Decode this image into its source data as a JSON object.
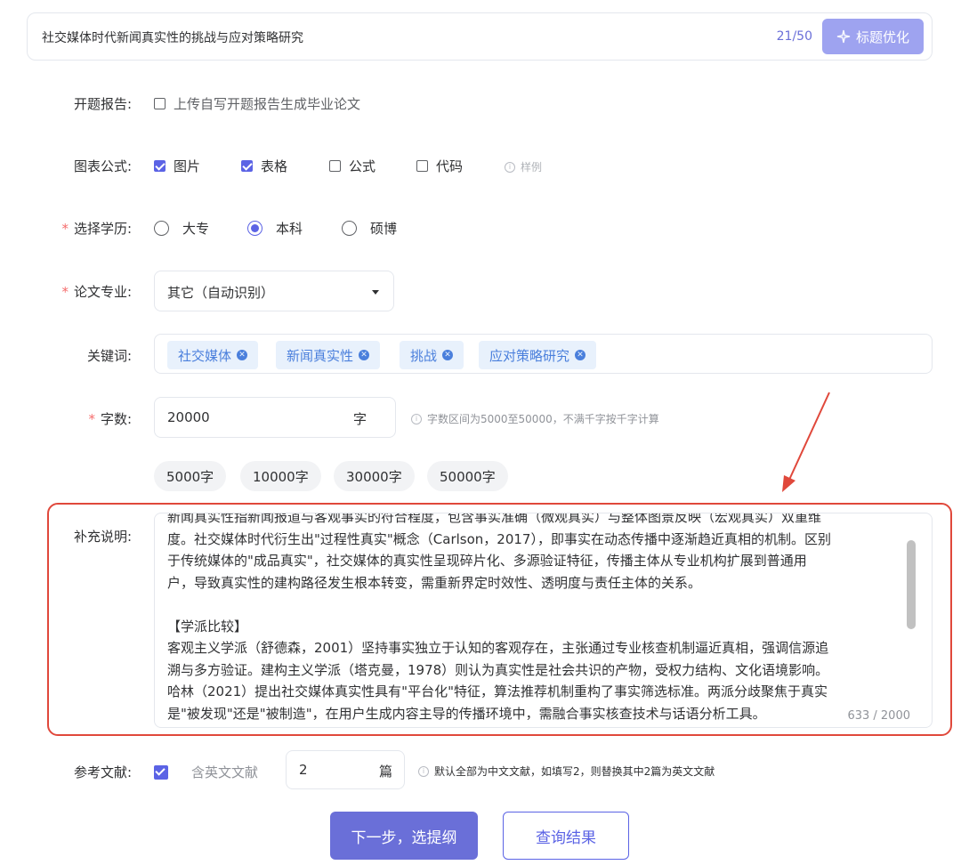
{
  "title": {
    "text": "社交媒体时代新闻真实性的挑战与应对策略研究",
    "count": "21/50",
    "optimize_label": "标题优化"
  },
  "proposal": {
    "label": "开题报告:",
    "option": "上传自写开题报告生成毕业论文",
    "checked": false
  },
  "charts": {
    "label": "图表公式:",
    "options": [
      {
        "label": "图片",
        "checked": true
      },
      {
        "label": "表格",
        "checked": true
      },
      {
        "label": "公式",
        "checked": false
      },
      {
        "label": "代码",
        "checked": false
      }
    ],
    "example_label": "样例"
  },
  "education": {
    "label": "选择学历:",
    "options": [
      {
        "label": "大专",
        "selected": false
      },
      {
        "label": "本科",
        "selected": true
      },
      {
        "label": "硕博",
        "selected": false
      }
    ]
  },
  "major": {
    "label": "论文专业:",
    "value": "其它（自动识别）"
  },
  "keywords": {
    "label": "关键词:",
    "tags": [
      "社交媒体",
      "新闻真实性",
      "挑战",
      "应对策略研究"
    ]
  },
  "word_count": {
    "label": "字数:",
    "value": "20000",
    "unit": "字",
    "hint": "字数区间为5000至50000，不满千字按千字计算",
    "presets": [
      "5000字",
      "10000字",
      "30000字",
      "50000字"
    ]
  },
  "supplement": {
    "label": "补充说明:",
    "lines": [
      "新闻真实性指新闻报道与客观事实的符合程度，包含事实准确（微观真实）与整体图景反映（宏观真实）双重维",
      "度。社交媒体时代衍生出\"过程性真实\"概念（Carlson，2017），即事实在动态传播中逐渐趋近真相的机制。区别",
      "于传统媒体的\"成品真实\"，社交媒体的真实性呈现碎片化、多源验证特征，传播主体从专业机构扩展到普通用",
      "户，导致真实性的建构路径发生根本转变，需重新界定时效性、透明度与责任主体的关系。",
      "",
      "【学派比较】",
      "客观主义学派（舒德森，2001）坚持事实独立于认知的客观存在，主张通过专业核查机制逼近真相，强调信源追",
      "溯与多方验证。建构主义学派（塔克曼，1978）则认为真实性是社会共识的产物，受权力结构、文化语境影响。",
      "哈林（2021）提出社交媒体真实性具有\"平台化\"特征，算法推荐机制重构了事实筛选标准。两派分歧聚焦于真实",
      "是\"被发现\"还是\"被制造\"，在用户生成内容主导的传播环境中，需融合事实核查技术与话语分析工具。"
    ],
    "count": "633 / 2000"
  },
  "references": {
    "label": "参考文献:",
    "include_english_label": "含英文文献",
    "include_english_checked": true,
    "value": "2",
    "unit": "篇",
    "hint": "默认全部为中文文献，如填写2，则替换其中2篇为英文文献"
  },
  "actions": {
    "next_label": "下一步，选提纲",
    "query_label": "查询结果"
  },
  "colors": {
    "primary": "#6a6fd8",
    "annotation": "#e0483b",
    "tag_text": "#4a7fdc"
  }
}
